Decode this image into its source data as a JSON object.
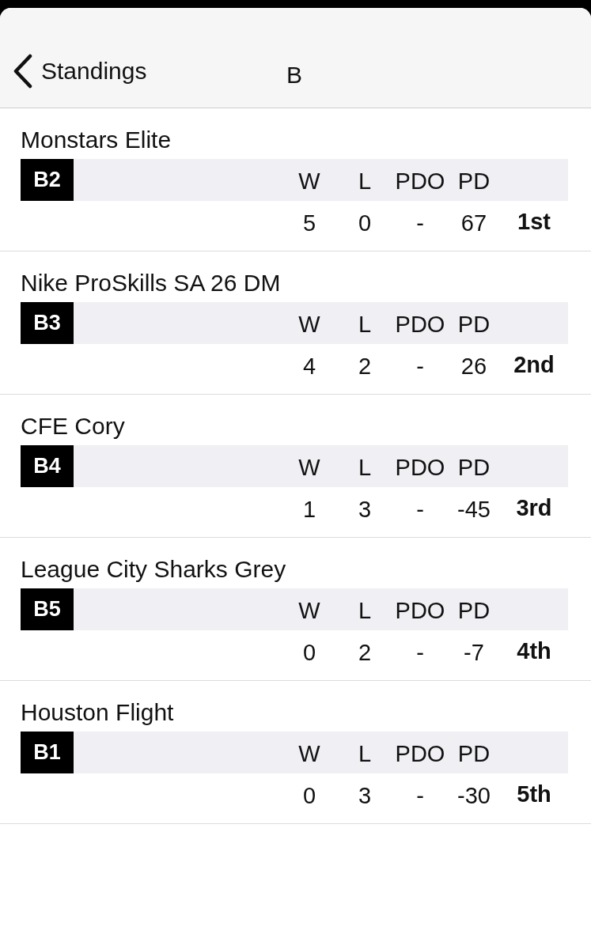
{
  "nav": {
    "back_label": "Standings",
    "title": "B"
  },
  "teams": [
    {
      "name": "Monstars Elite",
      "seed": "B2",
      "columns": [
        "W",
        "L",
        "PDO",
        "PD"
      ],
      "values": [
        "5",
        "0",
        "-",
        "67"
      ],
      "rank": "1st"
    },
    {
      "name": "Nike ProSkills SA 26 DM",
      "seed": "B3",
      "columns": [
        "W",
        "L",
        "PDO",
        "PD"
      ],
      "values": [
        "4",
        "2",
        "-",
        "26"
      ],
      "rank": "2nd"
    },
    {
      "name": "CFE Cory",
      "seed": "B4",
      "columns": [
        "W",
        "L",
        "PDO",
        "PD"
      ],
      "values": [
        "1",
        "3",
        "-",
        "-45"
      ],
      "rank": "3rd"
    },
    {
      "name": "League City Sharks Grey",
      "seed": "B5",
      "columns": [
        "W",
        "L",
        "PDO",
        "PD"
      ],
      "values": [
        "0",
        "2",
        "-",
        "-7"
      ],
      "rank": "4th"
    },
    {
      "name": "Houston Flight",
      "seed": "B1",
      "columns": [
        "W",
        "L",
        "PDO",
        "PD"
      ],
      "values": [
        "0",
        "3",
        "-",
        "-30"
      ],
      "rank": "5th"
    }
  ]
}
